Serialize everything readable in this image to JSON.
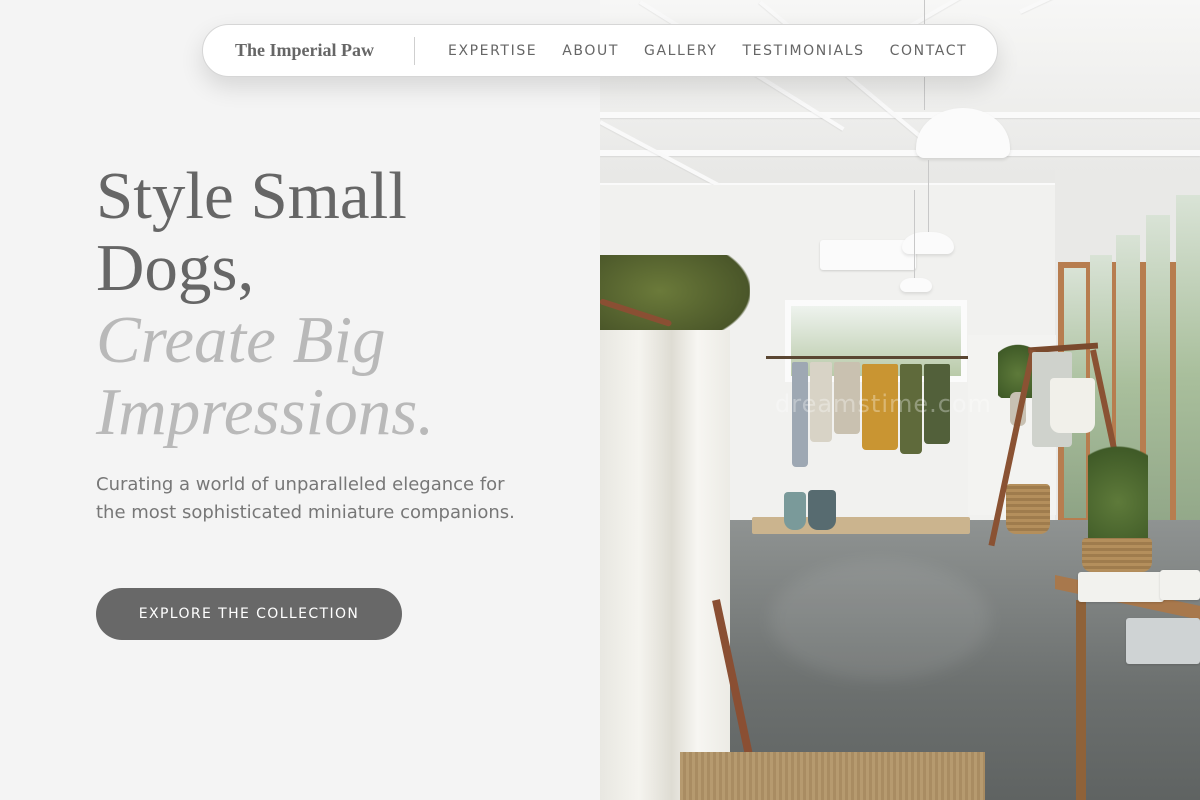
{
  "nav": {
    "brand": "The Imperial Paw",
    "links": [
      "EXPERTISE",
      "ABOUT",
      "GALLERY",
      "TESTIMONIALS",
      "CONTACT"
    ]
  },
  "hero": {
    "title_line1": "Style Small",
    "title_line2": "Dogs,",
    "title_line3": "Create Big",
    "title_line4": "Impressions.",
    "subtitle": "Curating a world of unparalleled elegance for the most sophisticated miniature companions.",
    "cta_label": "EXPLORE THE COLLECTION"
  },
  "image": {
    "watermark": "dreamstime.com"
  },
  "colors": {
    "text_primary": "#666666",
    "text_italic": "#b9b9b9",
    "button_bg": "#686868",
    "page_bg": "#f4f4f4"
  }
}
